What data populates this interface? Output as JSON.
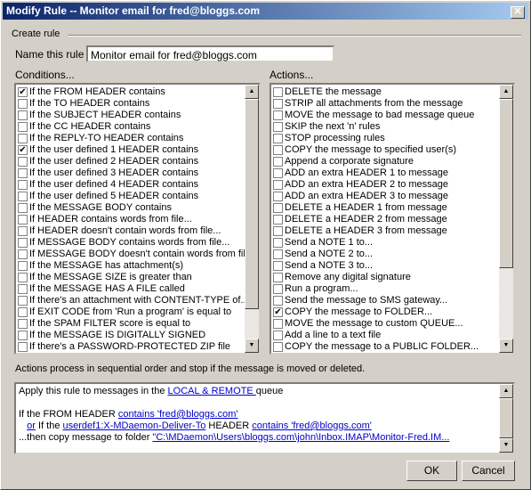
{
  "window": {
    "title": "Modify Rule -- Monitor email for fred@bloggs.com",
    "close": "✕"
  },
  "group_label": "Create rule",
  "name_label": "Name this rule",
  "name_value": "Monitor email for fred@bloggs.com",
  "conditions_label": "Conditions...",
  "actions_label": "Actions...",
  "conditions": [
    {
      "label": "If the FROM HEADER contains",
      "checked": true
    },
    {
      "label": "If the TO HEADER contains",
      "checked": false
    },
    {
      "label": "If the SUBJECT HEADER contains",
      "checked": false
    },
    {
      "label": "If the CC HEADER contains",
      "checked": false
    },
    {
      "label": "If the REPLY-TO HEADER contains",
      "checked": false
    },
    {
      "label": "If the user defined 1 HEADER contains",
      "checked": true
    },
    {
      "label": "If the user defined 2 HEADER contains",
      "checked": false
    },
    {
      "label": "If the user defined 3 HEADER contains",
      "checked": false
    },
    {
      "label": "If the user defined 4 HEADER contains",
      "checked": false
    },
    {
      "label": "If the user defined 5 HEADER contains",
      "checked": false
    },
    {
      "label": "If the MESSAGE BODY contains",
      "checked": false
    },
    {
      "label": "If HEADER contains words from file...",
      "checked": false
    },
    {
      "label": "If HEADER doesn't contain words from file...",
      "checked": false
    },
    {
      "label": "If MESSAGE BODY contains words from file...",
      "checked": false
    },
    {
      "label": "If MESSAGE BODY doesn't contain words from file.",
      "checked": false
    },
    {
      "label": "If the MESSAGE has attachment(s)",
      "checked": false
    },
    {
      "label": "If the MESSAGE SIZE is greater than",
      "checked": false
    },
    {
      "label": "If the MESSAGE HAS A FILE called",
      "checked": false
    },
    {
      "label": "If there's an attachment with CONTENT-TYPE of...",
      "checked": false
    },
    {
      "label": "If EXIT CODE from 'Run a program' is equal to",
      "checked": false
    },
    {
      "label": "If the SPAM FILTER score is equal to",
      "checked": false
    },
    {
      "label": "If the MESSAGE IS DIGITALLY SIGNED",
      "checked": false
    },
    {
      "label": "If there's a PASSWORD-PROTECTED ZIP file",
      "checked": false
    }
  ],
  "actions": [
    {
      "label": "DELETE the message",
      "checked": false
    },
    {
      "label": "STRIP all attachments from the message",
      "checked": false
    },
    {
      "label": "MOVE the message to bad message queue",
      "checked": false
    },
    {
      "label": "SKIP the next 'n' rules",
      "checked": false
    },
    {
      "label": "STOP processing rules",
      "checked": false
    },
    {
      "label": "COPY the message to specified user(s)",
      "checked": false
    },
    {
      "label": "Append a corporate signature",
      "checked": false
    },
    {
      "label": "ADD an extra HEADER 1 to message",
      "checked": false
    },
    {
      "label": "ADD an extra HEADER 2 to message",
      "checked": false
    },
    {
      "label": "ADD an extra HEADER 3 to message",
      "checked": false
    },
    {
      "label": "DELETE a HEADER 1 from message",
      "checked": false
    },
    {
      "label": "DELETE a HEADER 2 from message",
      "checked": false
    },
    {
      "label": "DELETE a HEADER 3 from message",
      "checked": false
    },
    {
      "label": "Send a NOTE 1 to...",
      "checked": false
    },
    {
      "label": "Send a NOTE 2 to...",
      "checked": false
    },
    {
      "label": "Send a NOTE 3 to...",
      "checked": false
    },
    {
      "label": "Remove any digital signature",
      "checked": false
    },
    {
      "label": "Run a program...",
      "checked": false
    },
    {
      "label": "Send the message to SMS gateway...",
      "checked": false
    },
    {
      "label": "COPY the message to FOLDER...",
      "checked": true
    },
    {
      "label": "MOVE the message to custom QUEUE...",
      "checked": false
    },
    {
      "label": "Add a line to a text file",
      "checked": false
    },
    {
      "label": "COPY the message to a PUBLIC FOLDER...",
      "checked": false
    }
  ],
  "note": "Actions process in sequential order and stop if the message is moved or deleted.",
  "summary": {
    "l1_pre": "Apply this rule to messages in the ",
    "l1_link": "LOCAL & REMOTE ",
    "l1_post": " queue",
    "l2_pre": "If the FROM HEADER ",
    "l2_link": "contains 'fred@bloggs.com'",
    "l3_or": "or",
    "l3_pre": " If the ",
    "l3_link1": "userdef1:X-MDaemon-Deliver-To",
    "l3_mid": " HEADER ",
    "l3_link2": "contains 'fred@bloggs.com'",
    "l4_pre": "...then copy message to folder ",
    "l4_link": "\"C:\\MDaemon\\Users\\bloggs.com\\john\\Inbox.IMAP\\Monitor-Fred.IM..."
  },
  "buttons": {
    "ok": "OK",
    "cancel": "Cancel"
  }
}
